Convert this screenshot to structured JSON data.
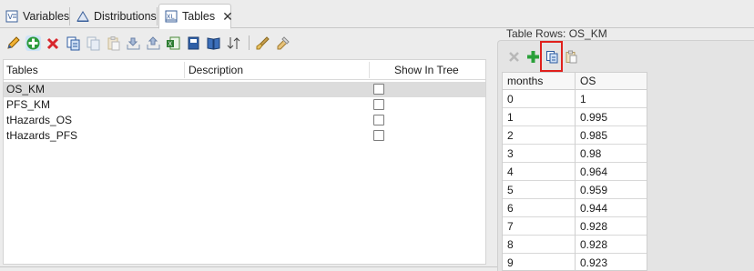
{
  "tabs": [
    {
      "label": "Variables",
      "icon": "variables-icon"
    },
    {
      "label": "Distributions",
      "icon": "distributions-icon"
    },
    {
      "label": "Tables",
      "icon": "tables-icon",
      "active": true
    }
  ],
  "toolbar": {
    "icons": [
      "edit-icon",
      "add-icon",
      "delete-icon",
      "copy-icon",
      "copy-disabled-icon",
      "paste-disabled-icon",
      "import-icon",
      "export-icon",
      "excel-icon",
      "book-icon",
      "book-open-icon",
      "sort-icon",
      "brush-icon",
      "tool-icon"
    ]
  },
  "tables": {
    "columns": [
      "Tables",
      "Description",
      "Show In Tree"
    ],
    "rows": [
      {
        "name": "OS_KM",
        "description": "",
        "show_in_tree": false,
        "selected": true
      },
      {
        "name": "PFS_KM",
        "description": "",
        "show_in_tree": false
      },
      {
        "name": "tHazards_OS",
        "description": "",
        "show_in_tree": false
      },
      {
        "name": "tHazards_PFS",
        "description": "",
        "show_in_tree": false
      }
    ]
  },
  "table_rows": {
    "title": "Table Rows: OS_KM",
    "columns": [
      "months",
      "OS"
    ],
    "rows": [
      [
        "0",
        "1"
      ],
      [
        "1",
        "0.995"
      ],
      [
        "2",
        "0.985"
      ],
      [
        "3",
        "0.98"
      ],
      [
        "4",
        "0.964"
      ],
      [
        "5",
        "0.959"
      ],
      [
        "6",
        "0.944"
      ],
      [
        "7",
        "0.928"
      ],
      [
        "8",
        "0.928"
      ],
      [
        "9",
        "0.923"
      ]
    ]
  },
  "colors": {
    "highlight": "#e0201c",
    "selected_row": "#dcdcdc"
  }
}
